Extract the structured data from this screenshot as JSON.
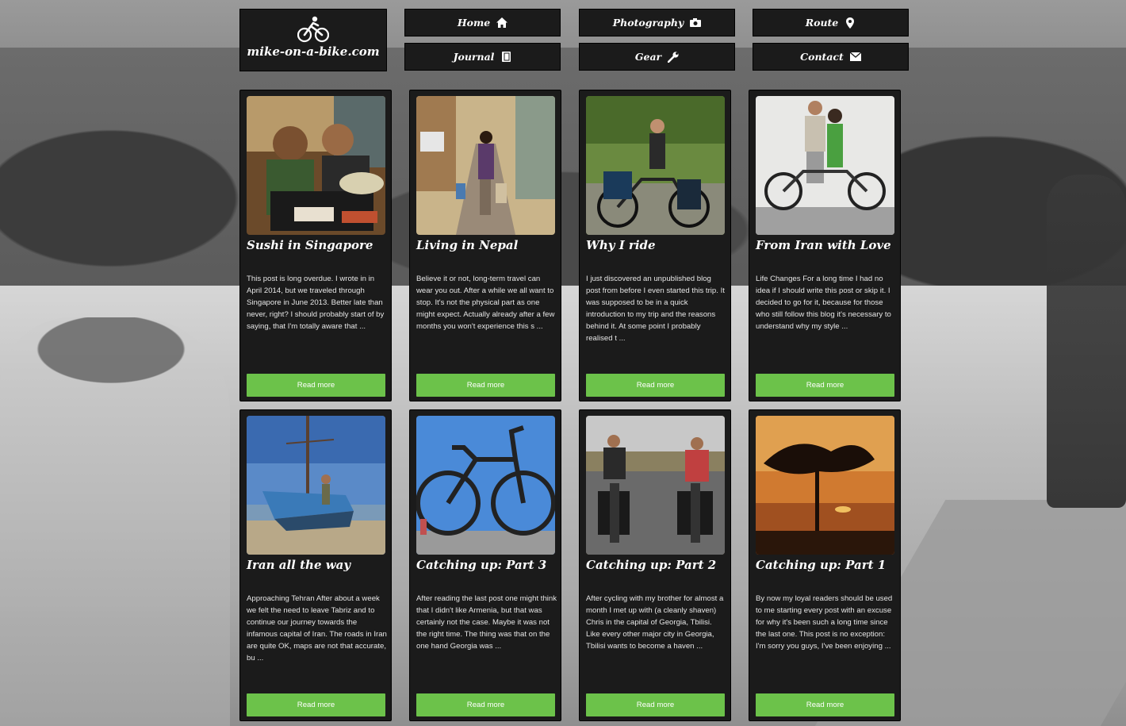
{
  "site": {
    "name": "mike-on-a-bike.com"
  },
  "nav": [
    {
      "label": "Home",
      "icon": "home-icon"
    },
    {
      "label": "Photography",
      "icon": "camera-icon"
    },
    {
      "label": "Route",
      "icon": "map-pin-icon"
    },
    {
      "label": "Journal",
      "icon": "book-icon"
    },
    {
      "label": "Gear",
      "icon": "wrench-icon"
    },
    {
      "label": "Contact",
      "icon": "envelope-icon"
    }
  ],
  "posts": [
    {
      "title": "Sushi in Singapore",
      "excerpt": "This post is long overdue. I wrote in in April 2014, but we traveled through Singapore in June 2013. Better late than never, right? I should probably start of by saying, that I'm totally aware that ...",
      "button": "Read more"
    },
    {
      "title": "Living in Nepal",
      "excerpt": "Believe it or not, long-term travel can wear you out. After a while we all want to stop. It's not the physical part as one might expect. Actually already after a few months you won't experience this s ...",
      "button": "Read more"
    },
    {
      "title": "Why I ride",
      "excerpt": "I just discovered an unpublished blog post from before I even started this trip. It was supposed to be in a quick introduction to my trip and the reasons behind it. At some point I probably realised t ...",
      "button": "Read more"
    },
    {
      "title": "From Iran with Love",
      "excerpt": "Life Changes For a long time I had no idea if I should write this post or skip it. I decided to go for it, because for those who still follow this blog it's necessary to understand why my style ...",
      "button": "Read more"
    },
    {
      "title": "Iran all the way",
      "excerpt": "Approaching Tehran After about a week we felt the need to leave Tabriz and to continue our journey towards the infamous capital of Iran. The roads in Iran are quite OK, maps are not that accurate, bu ...",
      "button": "Read more"
    },
    {
      "title": "Catching up: Part 3",
      "excerpt": "After reading the last post one might think that I didn't like Armenia, but that was certainly not the case. Maybe it was not the right time. The thing was that on the one hand Georgia was ...",
      "button": "Read more"
    },
    {
      "title": "Catching up: Part 2",
      "excerpt": "After cycling with my brother for almost a month I met up with (a cleanly shaven) Chris in the capital of Georgia, Tbilisi. Like every other major city in Georgia, Tbilisi wants to become a haven ...",
      "button": "Read more"
    },
    {
      "title": "Catching up: Part 1",
      "excerpt": "By now my loyal readers should be used to me starting every post with an excuse for why it's been such a long time since the last one. This post is no exception: I'm sorry you guys, I've been enjoying ...",
      "button": "Read more"
    }
  ],
  "colors": {
    "accent": "#6cc24a",
    "panel": "#1b1b1b"
  }
}
